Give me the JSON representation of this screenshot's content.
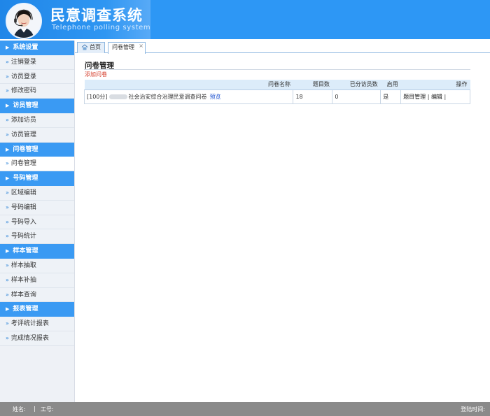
{
  "header": {
    "title": "民意调查系统",
    "subtitle": "Telephone polling system"
  },
  "sidebar": {
    "groups": [
      {
        "label": "系统设置",
        "items": [
          "注销登录",
          "访员登录",
          "修改密码"
        ]
      },
      {
        "label": "访员管理",
        "items": [
          "添加访员",
          "访员管理"
        ]
      },
      {
        "label": "问卷管理",
        "items": [
          "问卷管理"
        ]
      },
      {
        "label": "号码管理",
        "items": [
          "区域编辑",
          "号码编辑",
          "号码导入",
          "号码统计"
        ]
      },
      {
        "label": "样本管理",
        "items": [
          "样本抽取",
          "样本补抽",
          "样本查询"
        ]
      },
      {
        "label": "报表管理",
        "items": [
          "考评统计报表",
          "完成情况报表"
        ]
      }
    ]
  },
  "tabs": {
    "home": "首页",
    "active": "问卷管理"
  },
  "main": {
    "title": "问卷管理",
    "add_link": "添加问卷",
    "columns": {
      "name": "问卷名称",
      "questions": "题目数",
      "visited": "已分访员数",
      "enabled": "启用",
      "ops": "操作"
    },
    "rows": [
      {
        "score": "[100分]",
        "name": "社会治安综合治理民意调查问卷",
        "preview": "预览",
        "questions": "18",
        "visited": "0",
        "enabled": "是",
        "op_manage": "题目管理",
        "op_edit": "编辑"
      }
    ]
  },
  "footer": {
    "name_label": "姓名:",
    "separator": "|",
    "id_label": "工号:",
    "login_label": "登陆时间:"
  },
  "colors": {
    "header_blue": "#2d97f5",
    "nav_group_blue": "#3a9af3",
    "add_link_red": "#d43c2a",
    "footer_gray": "#8a8a8a"
  }
}
